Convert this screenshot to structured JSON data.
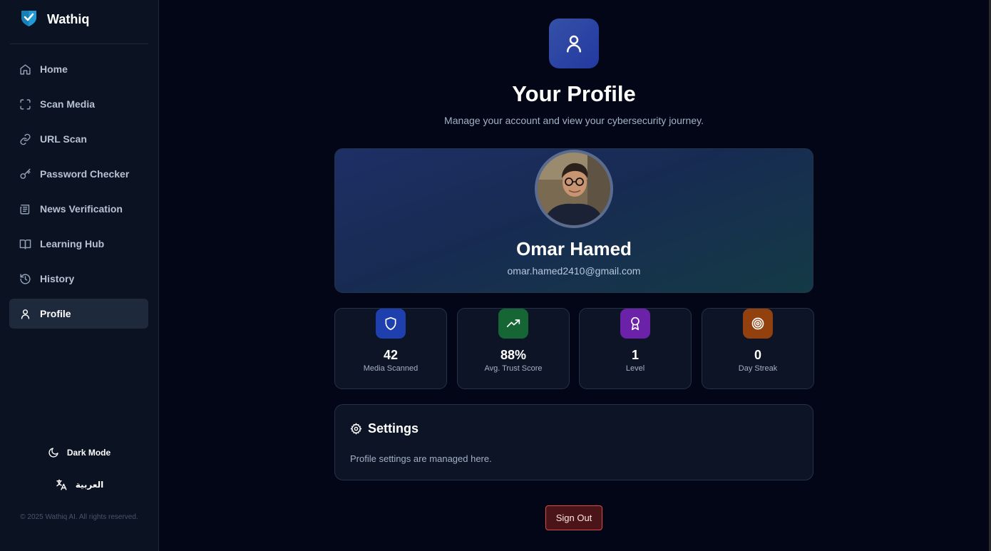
{
  "app": {
    "name": "Wathiq",
    "accent": "#1e9bd7"
  },
  "sidebar": {
    "items": [
      {
        "label": "Home",
        "icon": "home-icon"
      },
      {
        "label": "Scan Media",
        "icon": "scan-icon"
      },
      {
        "label": "URL Scan",
        "icon": "link-icon"
      },
      {
        "label": "Password Checker",
        "icon": "key-icon"
      },
      {
        "label": "News Verification",
        "icon": "newspaper-icon"
      },
      {
        "label": "Learning Hub",
        "icon": "book-icon"
      },
      {
        "label": "History",
        "icon": "history-icon"
      },
      {
        "label": "Profile",
        "icon": "user-icon",
        "active": true
      }
    ],
    "dark_mode_label": "Dark Mode",
    "language_label": "العربية",
    "copyright": "© 2025 Wathiq AI. All rights reserved."
  },
  "header": {
    "title": "Your Profile",
    "subtitle": "Manage your account and view your cybersecurity journey."
  },
  "profile": {
    "name": "Omar Hamed",
    "email": "omar.hamed2410@gmail.com"
  },
  "stats": [
    {
      "value": "42",
      "label": "Media Scanned",
      "icon": "shield-icon",
      "color": "#1e40af"
    },
    {
      "value": "88%",
      "label": "Avg. Trust Score",
      "icon": "trending-up-icon",
      "color": "#166534"
    },
    {
      "value": "1",
      "label": "Level",
      "icon": "award-icon",
      "color": "#6b21a8"
    },
    {
      "value": "0",
      "label": "Day Streak",
      "icon": "target-icon",
      "color": "#92400e"
    }
  ],
  "settings": {
    "title": "Settings",
    "text": "Profile settings are managed here."
  },
  "signout_label": "Sign Out"
}
